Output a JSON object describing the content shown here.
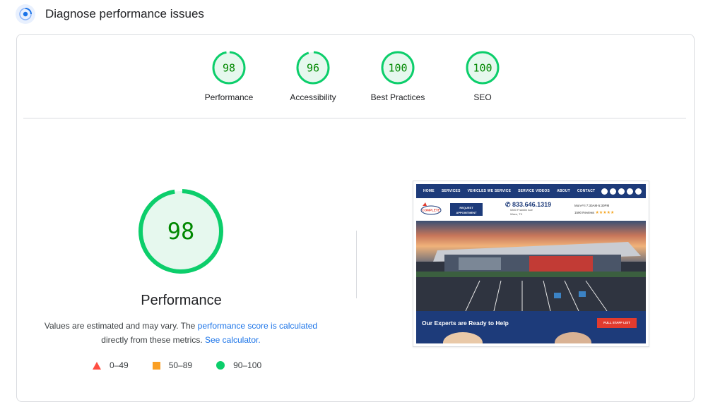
{
  "header": {
    "title": "Diagnose performance issues",
    "icon": "lighthouse-icon"
  },
  "gauges": [
    {
      "score": "98",
      "value": 98,
      "label": "Performance"
    },
    {
      "score": "96",
      "value": 96,
      "label": "Accessibility"
    },
    {
      "score": "100",
      "value": 100,
      "label": "Best Practices"
    },
    {
      "score": "100",
      "value": 100,
      "label": "SEO"
    }
  ],
  "main_gauge": {
    "score": "98",
    "value": 98,
    "title": "Performance"
  },
  "description": {
    "text1": "Values are estimated and may vary. The ",
    "link1": "performance score is calculated",
    "text2": " directly from these metrics. ",
    "link2": "See calculator."
  },
  "legend": [
    {
      "range": "0–49",
      "icon": "triangle-icon",
      "color": "#ff4e42"
    },
    {
      "range": "50–89",
      "icon": "square-icon",
      "color": "#ffa400"
    },
    {
      "range": "90–100",
      "icon": "circle-icon",
      "color": "#0cce6b"
    }
  ],
  "colors": {
    "pass": "#0cce6b",
    "pass_fill": "#e6f8ee",
    "pass_text": "#008800",
    "link": "#1a73e8"
  },
  "screenshot": {
    "nav": [
      "HOME",
      "SERVICES",
      "VEHICLES WE SERVICE",
      "SERVICE VIDEOS",
      "ABOUT",
      "CONTACT"
    ],
    "logo": "COMPLETE",
    "request_button": "REQUEST APPOINTMENT",
    "phone": "833.646.1319",
    "address1": "5300 Franklin Ave",
    "address2": "Waco, TX",
    "hours": "Mon-Fri 7:30AM-5:30PM",
    "reviews": "1590 Reviews",
    "stars": "★★★★★",
    "banner": "Our Experts are Ready to Help",
    "banner_button": "FULL STAFF LIST"
  }
}
